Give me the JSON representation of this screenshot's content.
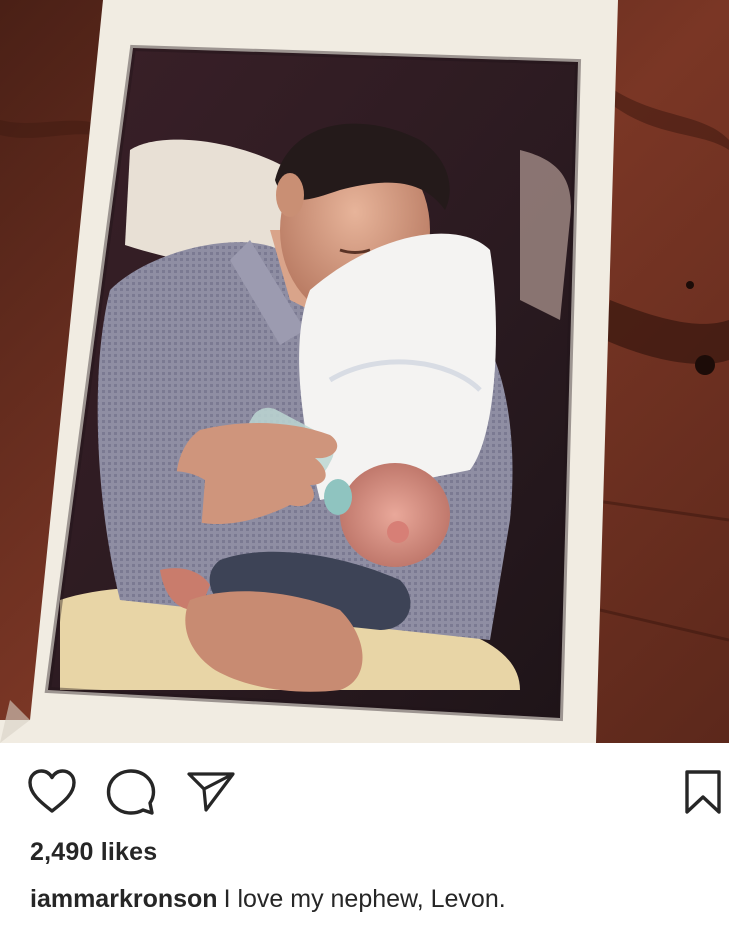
{
  "post": {
    "image_alt": "Instant photo of a man feeding a newborn baby with a bottle, lying on a wooden table",
    "actions": [
      {
        "name": "like",
        "icon": "heart-outline-icon"
      },
      {
        "name": "comment",
        "icon": "speech-bubble-icon"
      },
      {
        "name": "share",
        "icon": "paper-plane-icon"
      },
      {
        "name": "save",
        "icon": "bookmark-outline-icon"
      }
    ],
    "likes_label": "2,490 likes",
    "caption": {
      "username": "iammarkronson",
      "text": "I love my nephew, Levon."
    }
  },
  "colors": {
    "text": "#262626",
    "background": "#ffffff",
    "icon_stroke": "#262626"
  }
}
